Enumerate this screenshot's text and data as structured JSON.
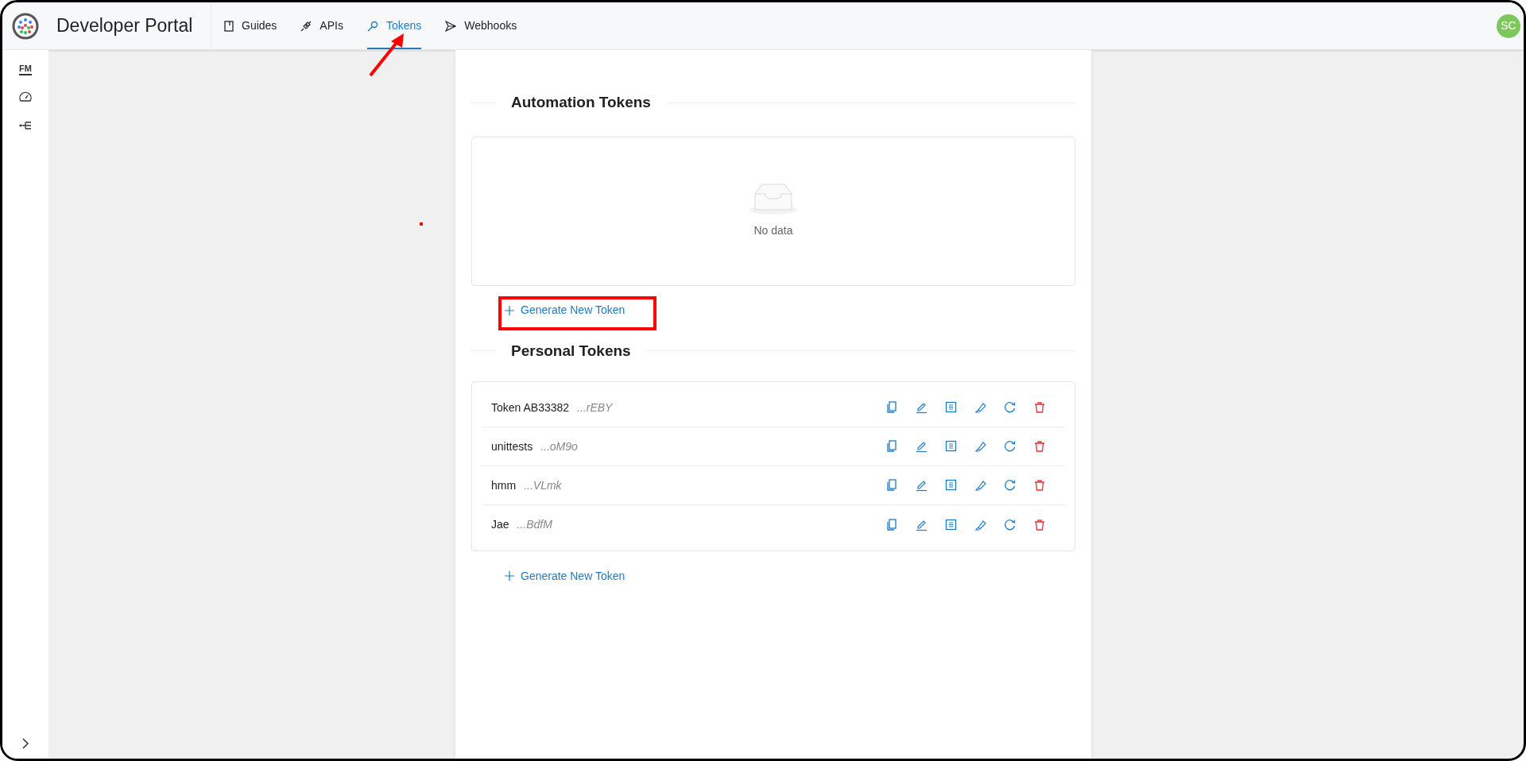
{
  "header": {
    "title": "Developer Portal",
    "tabs": [
      {
        "label": "Guides",
        "selected": false
      },
      {
        "label": "APIs",
        "selected": false
      },
      {
        "label": "Tokens",
        "selected": true
      },
      {
        "label": "Webhooks",
        "selected": false
      }
    ],
    "avatar": "SC"
  },
  "sidebar": {
    "badge": "FM"
  },
  "automation_tokens": {
    "title": "Automation Tokens",
    "empty_text": "No data",
    "generate_button": "Generate New Token"
  },
  "personal_tokens": {
    "title": "Personal Tokens",
    "tokens": [
      {
        "name": "Token AB33382",
        "suffix": "...rEBY"
      },
      {
        "name": "unittests",
        "suffix": "...oM9o"
      },
      {
        "name": "hmm",
        "suffix": "...VLmk"
      },
      {
        "name": "Jae",
        "suffix": "...BdfM"
      }
    ],
    "generate_button": "Generate New Token"
  }
}
